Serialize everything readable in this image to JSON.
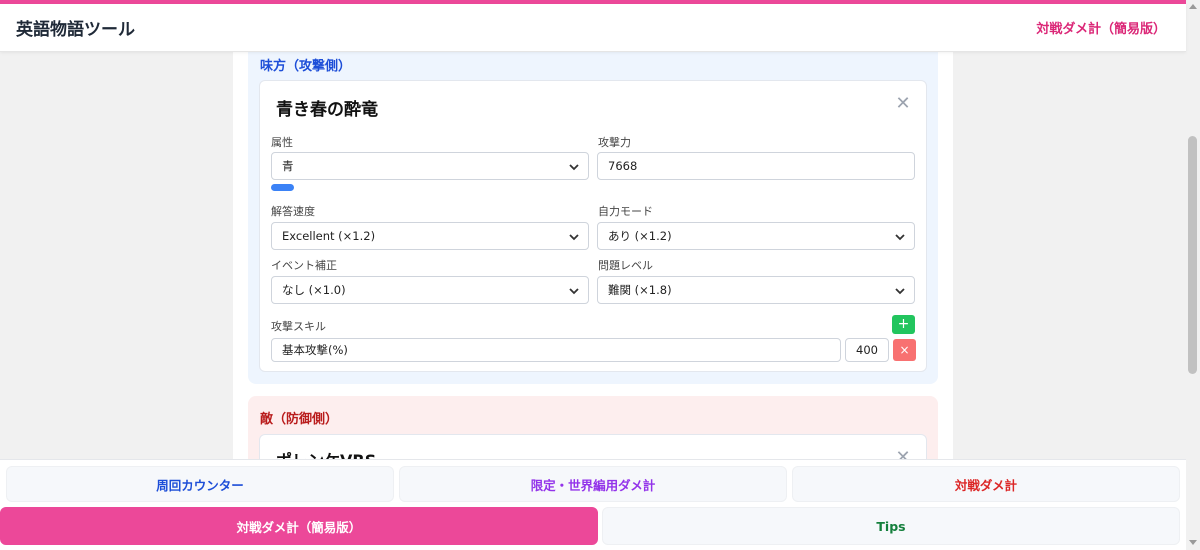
{
  "app": {
    "title": "英語物語ツール",
    "header_link": "対戦ダメ計（簡易版）"
  },
  "colors": {
    "accent": "#ec4899",
    "ally_title": "#1d4ed8",
    "enemy_title": "#b91c1c",
    "add_button": "#22c55e",
    "remove_button": "#f87171",
    "attribute_blue": "#3b82f6"
  },
  "ally": {
    "section_title": "味方（攻撃側）",
    "card": {
      "name": "青き春の酔竜",
      "attribute": {
        "label": "属性",
        "value": "青"
      },
      "attack": {
        "label": "攻撃力",
        "value": "7668"
      },
      "answer_speed": {
        "label": "解答速度",
        "value": "Excellent (×1.2)"
      },
      "self_mode": {
        "label": "自力モード",
        "value": "あり (×1.2)"
      },
      "event_bonus": {
        "label": "イベント補正",
        "value": "なし (×1.0)"
      },
      "question_level": {
        "label": "問題レベル",
        "value": "難関 (×1.8)"
      },
      "skills": {
        "label": "攻撃スキル",
        "add": "+",
        "items": [
          {
            "name": "基本攻撃(%)",
            "value": "400",
            "remove": "×"
          }
        ]
      }
    }
  },
  "enemy": {
    "section_title": "敵（防御側）",
    "card": {
      "name": "ポレンケVRS"
    }
  },
  "nav": {
    "items": [
      {
        "label": "周回カウンター",
        "color": "#1d4ed8"
      },
      {
        "label": "限定・世界編用ダメ計",
        "color": "#9333ea"
      },
      {
        "label": "対戦ダメ計",
        "color": "#dc2626"
      },
      {
        "label": "対戦ダメ計（簡易版）",
        "color": "#ffffff",
        "active": true
      },
      {
        "label": "Tips",
        "color": "#15803d"
      }
    ]
  }
}
